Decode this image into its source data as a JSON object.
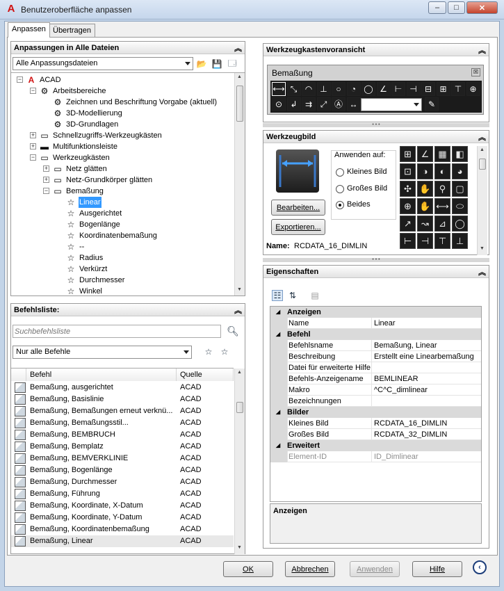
{
  "window": {
    "title": "Benutzeroberfläche anpassen",
    "min_label": "–",
    "max_label": "□",
    "close_label": "✕"
  },
  "tabs": [
    {
      "label": "Anpassen",
      "active": true
    },
    {
      "label": "Übertragen",
      "active": false
    }
  ],
  "customizations": {
    "header": "Anpassungen in Alle Dateien",
    "dropdown_value": "Alle Anpassungsdateien",
    "tree": [
      {
        "label": "ACAD",
        "level": 0,
        "expander": "−",
        "icon": "acad-icon"
      },
      {
        "label": "Arbeitsbereiche",
        "level": 1,
        "expander": "−",
        "icon": "workspace-gear-icon"
      },
      {
        "label": "Zeichnen und Beschriftung Vorgabe (aktuell)",
        "level": 2,
        "icon": "gear-icon"
      },
      {
        "label": "3D-Modellierung",
        "level": 2,
        "icon": "gear-icon"
      },
      {
        "label": "3D-Grundlagen",
        "level": 2,
        "icon": "gear-icon"
      },
      {
        "label": "Schnellzugriffs-Werkzeugkästen",
        "level": 1,
        "expander": "+",
        "icon": "toolbar-icon"
      },
      {
        "label": "Multifunktionsleiste",
        "level": 1,
        "expander": "+",
        "icon": "ribbon-icon"
      },
      {
        "label": "Werkzeugkästen",
        "level": 1,
        "expander": "−",
        "icon": "toolbar-icon"
      },
      {
        "label": "Netz glätten",
        "level": 2,
        "expander": "+",
        "icon": "toolbar-icon"
      },
      {
        "label": "Netz-Grundkörper glätten",
        "level": 2,
        "expander": "+",
        "icon": "toolbar-icon"
      },
      {
        "label": "Bemaßung",
        "level": 2,
        "expander": "−",
        "icon": "toolbar-icon"
      },
      {
        "label": "Linear",
        "level": 3,
        "icon": "star-icon",
        "selected": true
      },
      {
        "label": "Ausgerichtet",
        "level": 3,
        "icon": "star-icon"
      },
      {
        "label": "Bogenlänge",
        "level": 3,
        "icon": "star-icon"
      },
      {
        "label": "Koordinatenbemaßung",
        "level": 3,
        "icon": "star-icon"
      },
      {
        "label": "--",
        "level": 3,
        "icon": "star-icon"
      },
      {
        "label": "Radius",
        "level": 3,
        "icon": "star-icon"
      },
      {
        "label": "Verkürzt",
        "level": 3,
        "icon": "star-icon"
      },
      {
        "label": "Durchmesser",
        "level": 3,
        "icon": "star-icon"
      },
      {
        "label": "Winkel",
        "level": 3,
        "icon": "star-icon"
      }
    ]
  },
  "command_list": {
    "header": "Befehlsliste:",
    "search_placeholder": "Suchbefehlsliste",
    "filter_value": "Nur alle Befehle",
    "col_command": "Befehl",
    "col_source": "Quelle",
    "rows": [
      {
        "name": "Bemaßung, ausgerichtet",
        "source": "ACAD"
      },
      {
        "name": "Bemaßung, Basislinie",
        "source": "ACAD"
      },
      {
        "name": "Bemaßung, Bemaßungen erneut verknü...",
        "source": "ACAD"
      },
      {
        "name": "Bemaßung, Bemaßungsstil...",
        "source": "ACAD"
      },
      {
        "name": "Bemaßung, BEMBRUCH",
        "source": "ACAD"
      },
      {
        "name": "Bemaßung, Bemplatz",
        "source": "ACAD"
      },
      {
        "name": "Bemaßung, BEMVERKLINIE",
        "source": "ACAD"
      },
      {
        "name": "Bemaßung, Bogenlänge",
        "source": "ACAD"
      },
      {
        "name": "Bemaßung, Durchmesser",
        "source": "ACAD"
      },
      {
        "name": "Bemaßung, Führung",
        "source": "ACAD"
      },
      {
        "name": "Bemaßung, Koordinate, X-Datum",
        "source": "ACAD"
      },
      {
        "name": "Bemaßung, Koordinate, Y-Datum",
        "source": "ACAD"
      },
      {
        "name": "Bemaßung, Koordinatenbemaßung",
        "source": "ACAD"
      },
      {
        "name": "Bemaßung, Linear",
        "source": "ACAD",
        "highlighted": true
      }
    ]
  },
  "toolbar_preview": {
    "header": "Werkzeugkastenvoransicht",
    "toolbar_title": "Bemaßung"
  },
  "button_image": {
    "header": "Werkzeugbild",
    "apply_to_label": "Anwenden auf:",
    "options": [
      "Kleines Bild",
      "Großes Bild",
      "Beides"
    ],
    "selected_option": "Beides",
    "edit_label": "Bearbeiten...",
    "export_label": "Exportieren...",
    "name_label": "Name:",
    "name_value": "RCDATA_16_DIMLIN"
  },
  "properties": {
    "header": "Eigenschaften",
    "description_title": "Anzeigen",
    "categories": [
      {
        "name": "Anzeigen",
        "rows": [
          {
            "name": "Name",
            "value": "Linear"
          }
        ]
      },
      {
        "name": "Befehl",
        "rows": [
          {
            "name": "Befehlsname",
            "value": "Bemaßung, Linear"
          },
          {
            "name": "Beschreibung",
            "value": "Erstellt eine Linearbemaßung"
          },
          {
            "name": "Datei für erweiterte Hilfe",
            "value": ""
          },
          {
            "name": "Befehls-Anzeigename",
            "value": "BEMLINEAR"
          },
          {
            "name": "Makro",
            "value": "^C^C_dimlinear"
          },
          {
            "name": "Bezeichnungen",
            "value": ""
          }
        ]
      },
      {
        "name": "Bilder",
        "rows": [
          {
            "name": "Kleines Bild",
            "value": "RCDATA_16_DIMLIN"
          },
          {
            "name": "Großes Bild",
            "value": "RCDATA_32_DIMLIN"
          }
        ]
      },
      {
        "name": "Erweitert",
        "rows": [
          {
            "name": "Element-ID",
            "value": "ID_Dimlinear",
            "disabled": true
          }
        ]
      }
    ]
  },
  "footer": {
    "ok_label": "OK",
    "cancel_label": "Abbrechen",
    "apply_label": "Anwenden",
    "help_label": "Hilfe"
  }
}
